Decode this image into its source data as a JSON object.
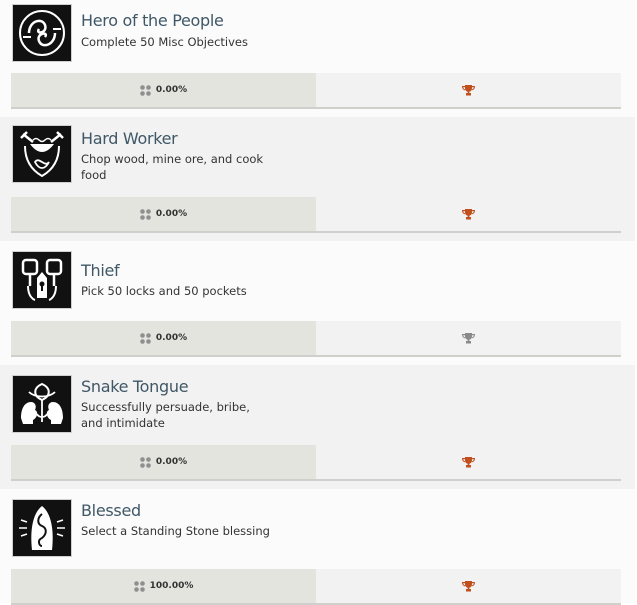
{
  "achievements": [
    {
      "title": "Hero of the People",
      "description": "Complete 50 Misc Objectives",
      "percent": "0.00%",
      "icon": "two-hands-swirl-icon",
      "trophy_color": "#c0501e"
    },
    {
      "title": "Hard Worker",
      "description": "Chop wood, mine ore, and cook food",
      "percent": "0.00%",
      "icon": "hammer-bowl-knot-icon",
      "trophy_color": "#c0501e"
    },
    {
      "title": "Thief",
      "description": "Pick 50 locks and 50 pockets",
      "percent": "0.00%",
      "icon": "keys-locks-icon",
      "trophy_color": "#8a8a8a"
    },
    {
      "title": "Snake Tongue",
      "description": "Successfully persuade, bribe, and intimidate",
      "percent": "0.00%",
      "icon": "twin-faces-knot-icon",
      "trophy_color": "#c0501e"
    },
    {
      "title": "Blessed",
      "description": "Select a Standing Stone blessing",
      "percent": "100.00%",
      "icon": "standing-stone-icon",
      "trophy_color": "#c0501e"
    }
  ],
  "colors": {
    "title": "#3f5766",
    "trophy_gold": "#c0501e",
    "trophy_grey": "#8a8a8a"
  }
}
